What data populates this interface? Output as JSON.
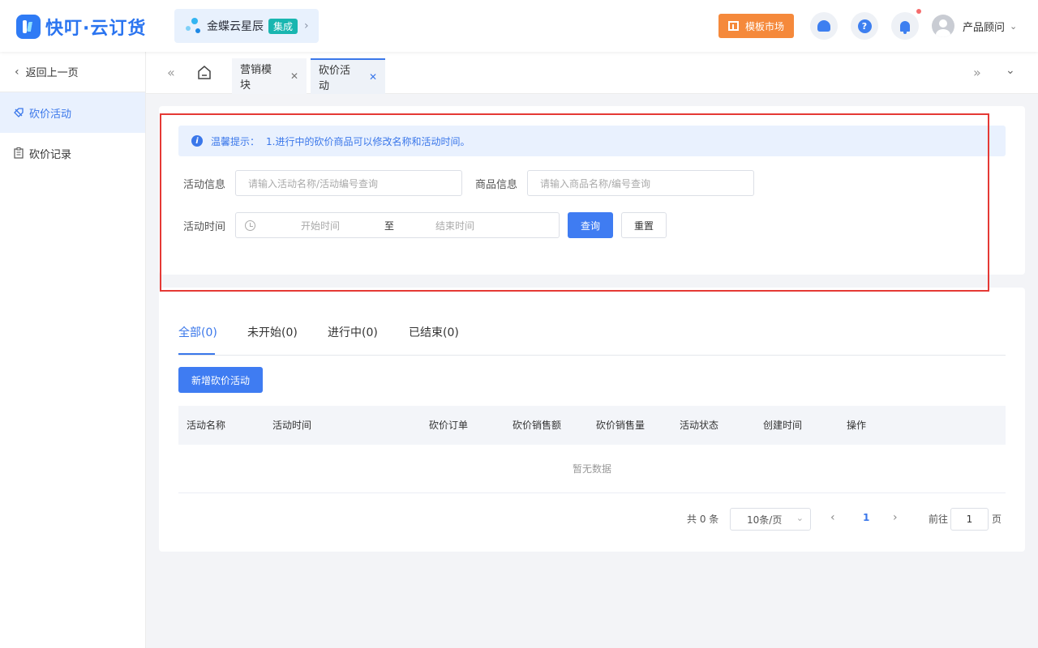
{
  "header": {
    "logo_text": "快叮·云订货",
    "brand": {
      "name": "金蝶云星辰",
      "tag": "集成",
      "arrow": "›"
    },
    "template_button": "模板市场",
    "user_name": "产品顾问",
    "user_caret": "⌄",
    "help_glyph": "?"
  },
  "sidebar": {
    "back_label": "返回上一页",
    "items": [
      {
        "label": "砍价活动",
        "icon": "tag-icon",
        "active": true
      },
      {
        "label": "砍价记录",
        "icon": "clipboard-icon",
        "active": false
      }
    ]
  },
  "tabbar": {
    "tabs": [
      {
        "label": "营销模块",
        "close": "✕"
      },
      {
        "label": "砍价活动",
        "close": "✕",
        "active": true
      }
    ]
  },
  "filter": {
    "notice_label": "温馨提示：",
    "notice_text": "1.进行中的砍价商品可以修改名称和活动时间。",
    "activity_info_label": "活动信息",
    "activity_info_placeholder": "请输入活动名称/活动编号查询",
    "product_info_label": "商品信息",
    "product_info_placeholder": "请输入商品名称/编号查询",
    "activity_time_label": "活动时间",
    "start_placeholder": "开始时间",
    "range_separator": "至",
    "end_placeholder": "结束时间",
    "query_button": "查询",
    "reset_button": "重置"
  },
  "status_tabs": [
    {
      "label": "全部(0)",
      "active": true
    },
    {
      "label": "未开始(0)",
      "active": false
    },
    {
      "label": "进行中(0)",
      "active": false
    },
    {
      "label": "已结束(0)",
      "active": false
    }
  ],
  "add_button": "新增砍价活动",
  "table": {
    "columns": [
      "活动名称",
      "活动时间",
      "砍价订单",
      "砍价销售额",
      "砍价销售量",
      "活动状态",
      "创建时间",
      "操作"
    ],
    "rows": [],
    "empty_text": "暂无数据"
  },
  "pagination": {
    "total": "共 0 条",
    "page_size": "10条/页",
    "current_page": "1",
    "goto_label": "前往",
    "goto_value": "1",
    "page_suffix": "页"
  },
  "colors": {
    "primary": "#3f7cf2",
    "orange": "#f5893b",
    "highlight": "#e53935",
    "teal_tag": "#19b6b0"
  }
}
